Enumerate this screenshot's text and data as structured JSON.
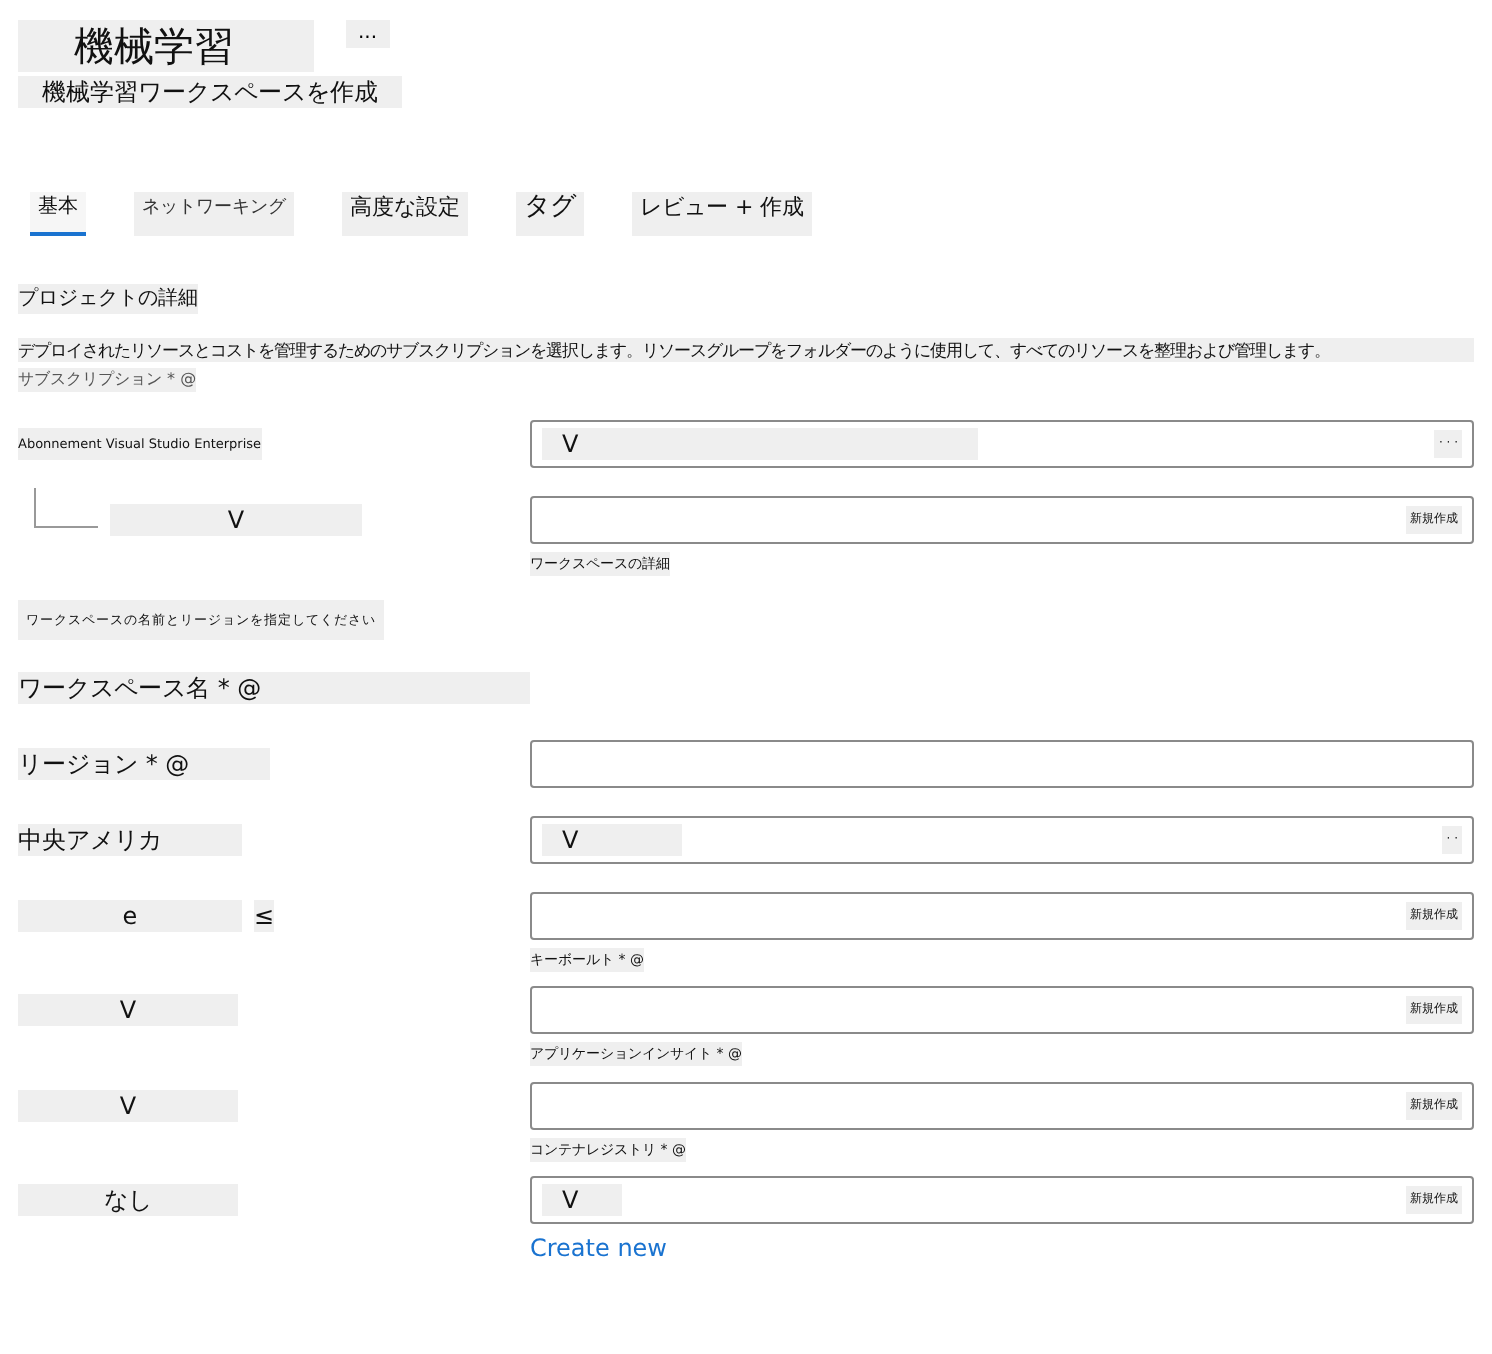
{
  "header": {
    "title": "機械学習",
    "more": "...",
    "subtitle": "機械学習ワークスペースを作成"
  },
  "tabs": [
    {
      "label": "基本",
      "selected": true
    },
    {
      "label": "ネットワーキング",
      "selected": false
    },
    {
      "label": "高度な設定",
      "selected": false
    },
    {
      "label": "タグ",
      "selected": false
    },
    {
      "label": "レビュー + 作成",
      "selected": false
    }
  ],
  "section_title": "プロジェクトの詳細",
  "description": "デプロイされたリソースとコストを管理するためのサブスクリプションを選択します。リソースグループをフォルダーのように使用して、すべてのリソースを整理および管理します。",
  "subscription_label": "サブスクリプション * @",
  "rows": [
    {
      "kind": "subscription",
      "label": "Abonnement Visual Studio Enterprise",
      "field": {
        "kind": "dropdown",
        "value": "V",
        "action": "· · ·"
      }
    },
    {
      "kind": "field",
      "label": "V",
      "tree": true,
      "field": {
        "kind": "text",
        "action": "新規作成"
      },
      "hint": "ワークスペースの詳細"
    },
    {
      "kind": "note",
      "label": "ワークスペースの名前とリージョンを指定してください"
    },
    {
      "kind": "heading",
      "label": "ワークスペース名 * @"
    },
    {
      "kind": "field",
      "label": "リージョン * @",
      "field": {
        "kind": "text"
      }
    },
    {
      "kind": "field",
      "label": "中央アメリカ",
      "field": {
        "kind": "dropdown",
        "value": "V",
        "action": "· ·"
      }
    },
    {
      "kind": "field",
      "label": "e",
      "extra": "≤",
      "field": {
        "kind": "text",
        "action": "新規作成"
      },
      "hint": "キーボールト * @"
    },
    {
      "kind": "field",
      "label": "V",
      "field": {
        "kind": "text",
        "action": "新規作成"
      },
      "hint": "アプリケーションインサイト * @"
    },
    {
      "kind": "field",
      "label": "V",
      "field": {
        "kind": "text",
        "action": "新規作成"
      },
      "hint": "コンテナレジストリ * @"
    },
    {
      "kind": "field",
      "label": "なし",
      "field": {
        "kind": "dropdown",
        "value": "V",
        "action": "新規作成"
      },
      "link": "Create new"
    }
  ]
}
